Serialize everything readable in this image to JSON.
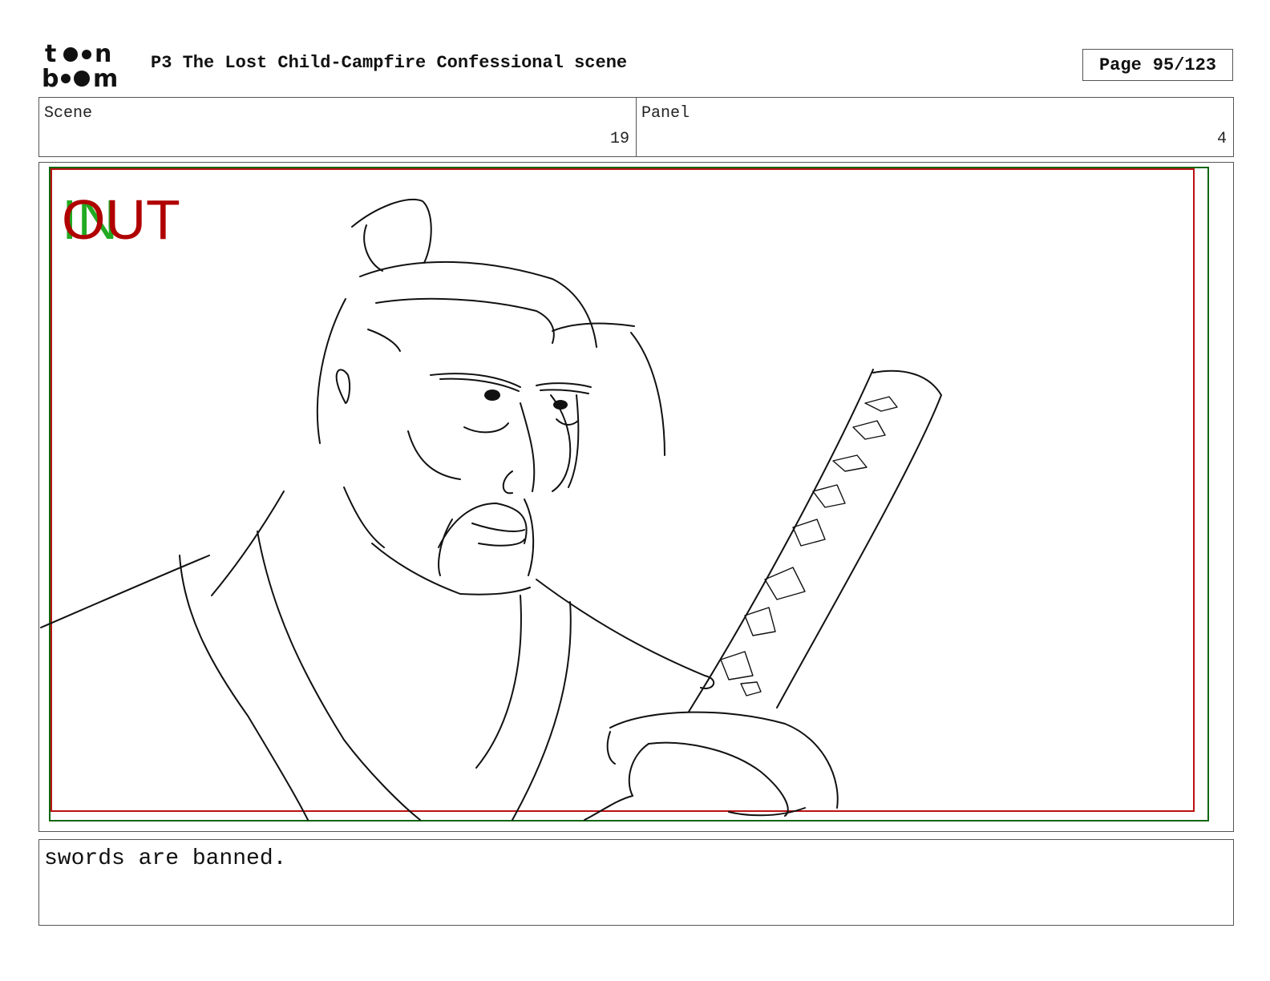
{
  "header": {
    "logo_text": "toon boom",
    "project_title": "P3 The Lost Child-Campfire Confessional scene",
    "page_label": "Page",
    "page_number": "95/123"
  },
  "info": {
    "scene_label": "Scene",
    "scene_value": "19",
    "panel_label": "Panel",
    "panel_value": "4"
  },
  "panel": {
    "in_marker": "IN",
    "out_marker": "OUT",
    "colors": {
      "in": "#22aa22",
      "out": "#b00000",
      "frame_green": "#116611",
      "frame_red": "#bb1111"
    }
  },
  "caption": {
    "text": "swords are banned."
  }
}
